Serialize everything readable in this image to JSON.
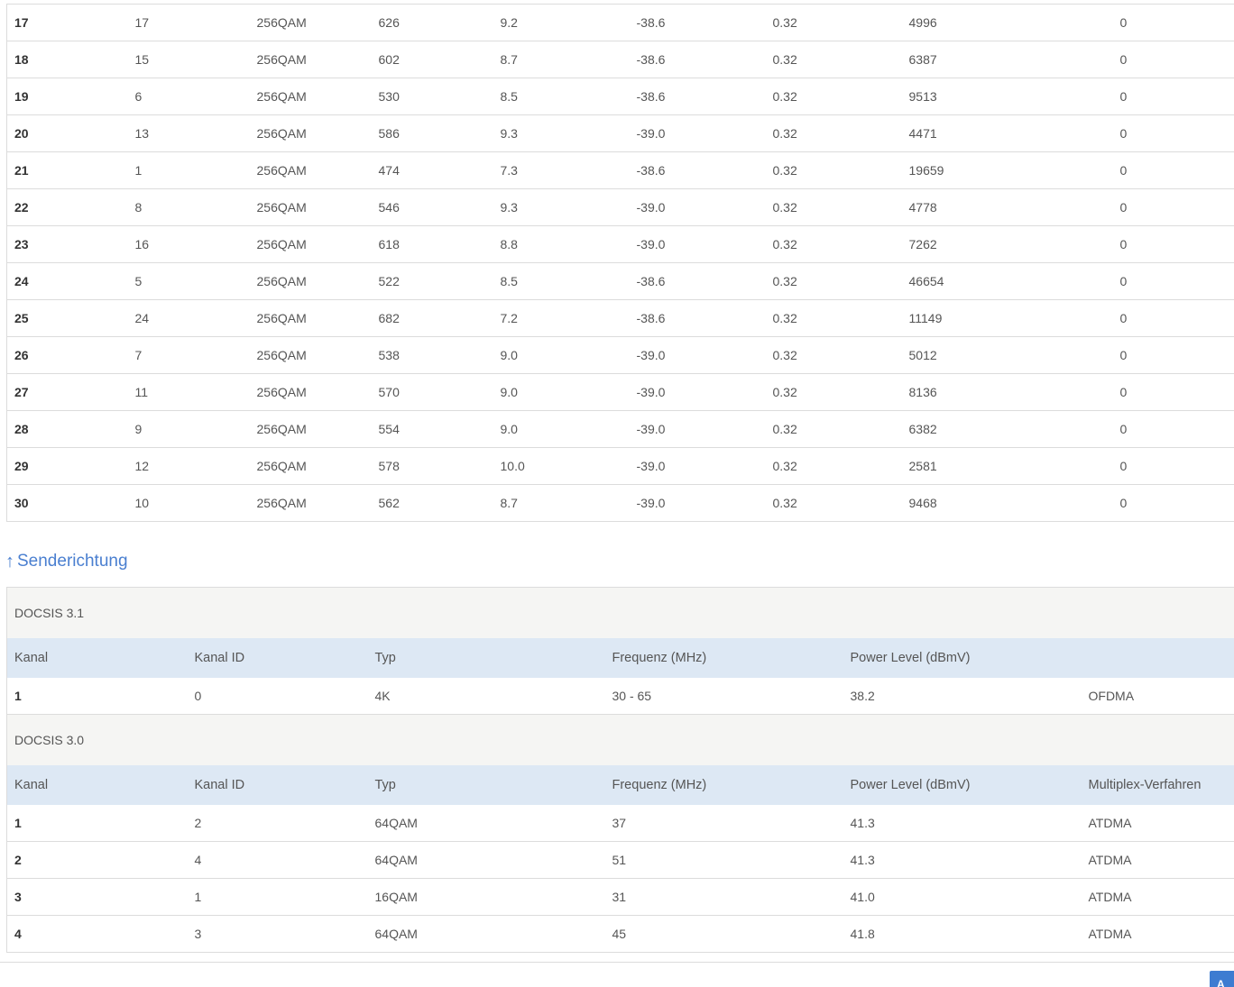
{
  "downstream": {
    "rows": [
      [
        "17",
        "17",
        "256QAM",
        "626",
        "9.2",
        "-38.6",
        "0.32",
        "4996",
        "0"
      ],
      [
        "18",
        "15",
        "256QAM",
        "602",
        "8.7",
        "-38.6",
        "0.32",
        "6387",
        "0"
      ],
      [
        "19",
        "6",
        "256QAM",
        "530",
        "8.5",
        "-38.6",
        "0.32",
        "9513",
        "0"
      ],
      [
        "20",
        "13",
        "256QAM",
        "586",
        "9.3",
        "-39.0",
        "0.32",
        "4471",
        "0"
      ],
      [
        "21",
        "1",
        "256QAM",
        "474",
        "7.3",
        "-38.6",
        "0.32",
        "19659",
        "0"
      ],
      [
        "22",
        "8",
        "256QAM",
        "546",
        "9.3",
        "-39.0",
        "0.32",
        "4778",
        "0"
      ],
      [
        "23",
        "16",
        "256QAM",
        "618",
        "8.8",
        "-39.0",
        "0.32",
        "7262",
        "0"
      ],
      [
        "24",
        "5",
        "256QAM",
        "522",
        "8.5",
        "-38.6",
        "0.32",
        "46654",
        "0"
      ],
      [
        "25",
        "24",
        "256QAM",
        "682",
        "7.2",
        "-38.6",
        "0.32",
        "11149",
        "0"
      ],
      [
        "26",
        "7",
        "256QAM",
        "538",
        "9.0",
        "-39.0",
        "0.32",
        "5012",
        "0"
      ],
      [
        "27",
        "11",
        "256QAM",
        "570",
        "9.0",
        "-39.0",
        "0.32",
        "8136",
        "0"
      ],
      [
        "28",
        "9",
        "256QAM",
        "554",
        "9.0",
        "-39.0",
        "0.32",
        "6382",
        "0"
      ],
      [
        "29",
        "12",
        "256QAM",
        "578",
        "10.0",
        "-39.0",
        "0.32",
        "2581",
        "0"
      ],
      [
        "30",
        "10",
        "256QAM",
        "562",
        "8.7",
        "-39.0",
        "0.32",
        "9468",
        "0"
      ]
    ]
  },
  "upstream": {
    "heading_arrow": "↑",
    "heading": "Senderichtung",
    "docsis31": {
      "title": "DOCSIS 3.1",
      "headers": [
        "Kanal",
        "Kanal ID",
        "Typ",
        "Frequenz (MHz)",
        "Power Level (dBmV)",
        ""
      ],
      "rows": [
        [
          "1",
          "0",
          "4K",
          "30 - 65",
          "38.2",
          "OFDMA"
        ]
      ]
    },
    "docsis30": {
      "title": "DOCSIS 3.0",
      "headers": [
        "Kanal",
        "Kanal ID",
        "Typ",
        "Frequenz (MHz)",
        "Power Level (dBmV)",
        "Multiplex-Verfahren"
      ],
      "rows": [
        [
          "1",
          "2",
          "64QAM",
          "37",
          "41.3",
          "ATDMA"
        ],
        [
          "2",
          "4",
          "64QAM",
          "51",
          "41.3",
          "ATDMA"
        ],
        [
          "3",
          "1",
          "16QAM",
          "31",
          "41.0",
          "ATDMA"
        ],
        [
          "4",
          "3",
          "64QAM",
          "45",
          "41.8",
          "ATDMA"
        ]
      ]
    }
  },
  "corner_button": {
    "label": "A"
  }
}
